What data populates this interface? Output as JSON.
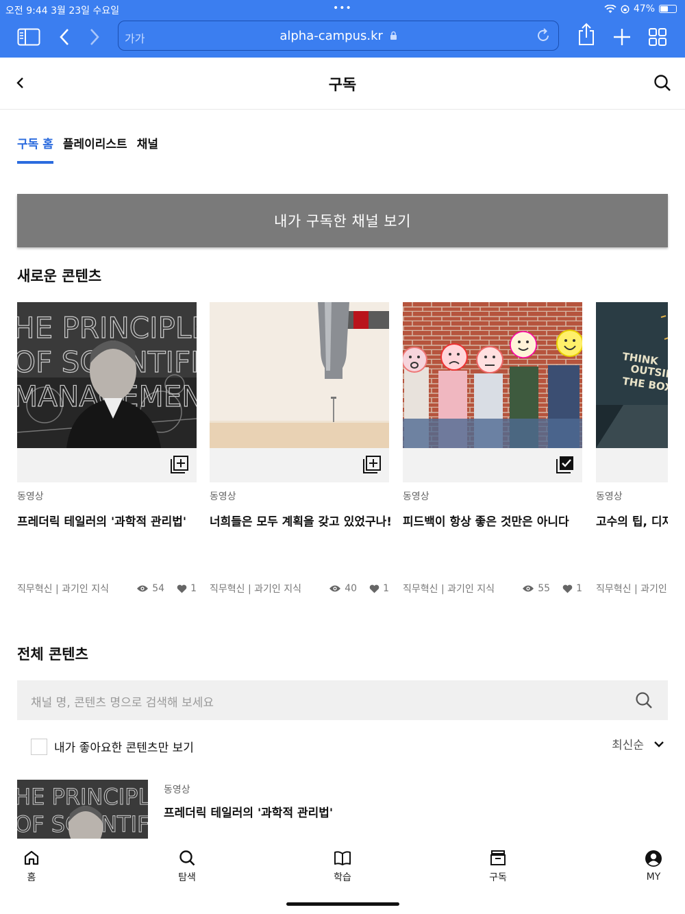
{
  "status_bar": {
    "time_date": "오전 9:44   3월 23일 수요일",
    "dots": "•••",
    "battery": "47%",
    "battery_level": 0.47
  },
  "browser": {
    "aa": "가가",
    "url": "alpha-campus.kr"
  },
  "header": {
    "title": "구독"
  },
  "tabs": [
    {
      "label": "구독 홈",
      "active": true
    },
    {
      "label": "플레이리스트",
      "active": false
    },
    {
      "label": "채널",
      "active": false
    }
  ],
  "subscribe_button": "내가 구독한 채널 보기",
  "new_section_title": "새로운 콘텐츠",
  "cards": [
    {
      "kind": "동영상",
      "title": "프레더릭 테일러의 '과학적 관리법'",
      "category": "직무혁신 | 과기인 지식",
      "views": "54",
      "likes": "1",
      "icon": "playlist-add-icon"
    },
    {
      "kind": "동영상",
      "title": "너희들은 모두 계획을 갖고 있었구나!",
      "category": "직무혁신 | 과기인 지식",
      "views": "40",
      "likes": "1",
      "icon": "playlist-add-icon"
    },
    {
      "kind": "동영상",
      "title": "피드백이 항상 좋은 것만은 아니다",
      "category": "직무혁신 | 과기인 지식",
      "views": "55",
      "likes": "1",
      "icon": "playlist-added-icon"
    },
    {
      "kind": "동영상",
      "title": "고수의 팁, 디자",
      "category": "직무혁신 | 과기인",
      "views": "",
      "likes": "",
      "icon": ""
    }
  ],
  "all_section_title": "전체 콘텐츠",
  "search": {
    "placeholder": "채널 명, 콘텐츠 명으로 검색해 보세요"
  },
  "filter": {
    "liked_only_label": "내가 좋아요한 콘텐츠만 보기",
    "sort_label": "최신순"
  },
  "list_items": [
    {
      "kind": "동영상",
      "title": "프레더릭 테일러의 '과학적 관리법'"
    }
  ],
  "bottom_nav": [
    {
      "label": "홈",
      "icon": "home-icon"
    },
    {
      "label": "탐색",
      "icon": "search-icon"
    },
    {
      "label": "학습",
      "icon": "book-icon"
    },
    {
      "label": "구독",
      "icon": "archive-icon"
    },
    {
      "label": "MY",
      "icon": "user-icon"
    }
  ],
  "colors": {
    "browser_bar": "#3b7ef0",
    "accent": "#2b6bde",
    "button_gray": "#7a7a7a"
  }
}
